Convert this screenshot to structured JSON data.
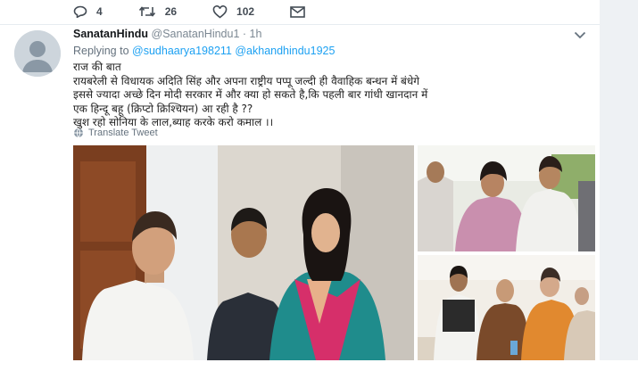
{
  "prev_tweet_actions": {
    "replies": "4",
    "retweets": "26",
    "likes": "102"
  },
  "tweet": {
    "author_name": "SanatanHindu",
    "handle_time": "@SanatanHindu1 · 1h",
    "replying_prefix": "Replying to",
    "reply_handles": "@sudhaarya198211 @akhandhindu1925",
    "text_lines": [
      "राज की बात",
      "रायबरेली से विधायक अदिति सिंह और अपना राष्ट्रीय पप्पू जल्दी ही वैवाहिक बन्धन में बंधेगे",
      "इससे ज्यादा अच्छे दिन मोदी सरकार में और क्या हो सकते है,कि पहली बार गांधी खानदान में",
      "एक हिन्दू बहू (क्रिप्टो क्रिश्चियन) आ रही है ??",
      "खुश रहो सोनिया के लाल,ब्याह करके करो कमाल ।।"
    ],
    "translate_label": "Translate Tweet"
  },
  "icons": {
    "reply": "reply-icon",
    "retweet": "retweet-icon",
    "like": "heart-icon",
    "dm": "envelope-icon",
    "caret": "chevron-down-icon",
    "translate": "globe-icon"
  },
  "colors": {
    "link": "#1da1f2",
    "muted": "#65727e",
    "action": "#444c55"
  }
}
